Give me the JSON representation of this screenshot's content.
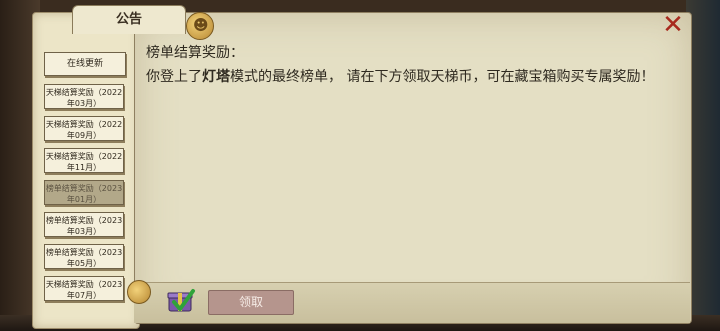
{
  "panel": {
    "tab_title": "公告"
  },
  "sidebar": {
    "online_update": "在线更新",
    "items": [
      {
        "line1": "天梯结算奖励（2022",
        "line2": "年03月）",
        "selected": false
      },
      {
        "line1": "天梯结算奖励（2022",
        "line2": "年09月）",
        "selected": false
      },
      {
        "line1": "天梯结算奖励（2022",
        "line2": "年11月）",
        "selected": false
      },
      {
        "line1": "榜单结算奖励（2023",
        "line2": "年01月）",
        "selected": true
      },
      {
        "line1": "榜单结算奖励（2023",
        "line2": "年03月）",
        "selected": false
      },
      {
        "line1": "榜单结算奖励（2023",
        "line2": "年05月）",
        "selected": false
      },
      {
        "line1": "天梯结算奖励（2023",
        "line2": "年07月）",
        "selected": false
      }
    ]
  },
  "content": {
    "heading": "榜单结算奖励：",
    "message_before": "你登上了",
    "message_bold": "灯塔",
    "message_after": "模式的最终榜单， 请在下方领取天梯币，可在藏宝箱购买专属奖励！"
  },
  "footer": {
    "claim_label": "领取"
  },
  "icons": {
    "close": "close-icon",
    "tab_decoration": "coin-badge-icon",
    "reward": "gift-check-icon"
  }
}
